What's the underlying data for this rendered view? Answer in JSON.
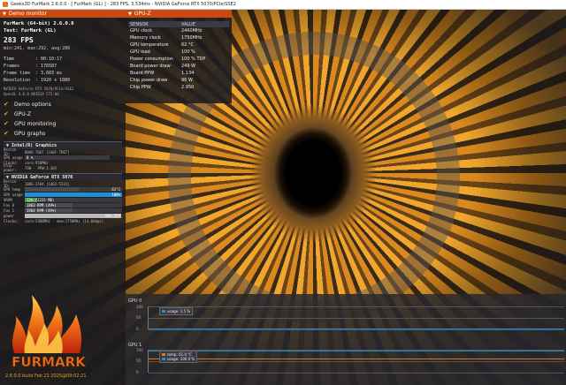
{
  "window": {
    "title": "Geeks3D FurMark 2.6.0.0 - [ FurMark (GL) ] - 283 FPS, 3.534ms - NVIDIA GeForce RTX 5070/PCIe/SSE2"
  },
  "demo_monitor": {
    "header": "Demo monitor",
    "title_line": "FurMark (64-bit) 2.6.0.0",
    "test_line": "Test: FurMark (GL)",
    "fps": "283 FPS",
    "minmaxavg": "min:241, max:292, avg:286",
    "stats": [
      {
        "k": "Time",
        "v": ": 00:10:17"
      },
      {
        "k": "Frames",
        "v": ": 176587"
      },
      {
        "k": "Frame time",
        "v": ": 3.603 ms"
      },
      {
        "k": "Resolution",
        "v": ": 1920 x 1080"
      }
    ],
    "gl_renderer": "NVIDIA GeForce RTX 5070/PCIe/SSE2",
    "gl_version": "OpenGL 4.6.0 NVIDIA 572.00",
    "options": [
      {
        "label": "Demo options"
      },
      {
        "label": "GPU-Z"
      },
      {
        "label": "GPU monitoring"
      },
      {
        "label": "GPU graphs"
      }
    ]
  },
  "intel_gpu": {
    "header": "Intel(R) Graphics",
    "rows": [
      {
        "k": "Device ID:",
        "v": "8086-7D67 [1A0F-7D67]"
      },
      {
        "k": "GPU usage",
        "bar": "0 %"
      },
      {
        "k": "Clocks:",
        "v": "core:950MHz"
      },
      {
        "k": "Chip power:",
        "v": "79W - PPW:3.305"
      }
    ]
  },
  "nvidia_gpu": {
    "header": "NVIDIA GeForce RTX 5070",
    "device": "10DE-2F04 [1462-5331]",
    "rows": [
      {
        "k": "GPU temp",
        "text": "61°C",
        "fill": 0.55,
        "color": "#4a4a52"
      },
      {
        "k": "GPU usage",
        "text": "100%",
        "fill": 1.0,
        "color": "#1f8fd4"
      },
      {
        "k": "VRAM",
        "text": "13% (1233 MB)",
        "fill": 0.13,
        "color": "#4a9a4a"
      },
      {
        "k": "Fan 0",
        "text": "1863 RPM (49%)",
        "fill": 0.49,
        "color": "#4a4a52"
      },
      {
        "k": "Fan 1",
        "text": "1964 RPM (49%)",
        "fill": 0.49,
        "color": "#4a4a52"
      },
      {
        "k": "power",
        "text": "99% TDP",
        "fill": 0.99,
        "color": "#b8b8b8"
      }
    ],
    "clocks": "core:2460MHz - mem:1750MHz (14.0Gbps)"
  },
  "logo_text": "FURMARK",
  "build": "2.6.0.0 build Feb 21 2025@09:02:21",
  "gpuz": {
    "header": "GPU-Z",
    "col_sensor": "SENSOR",
    "col_value": "VALUE",
    "rows": [
      {
        "s": "GPU clock",
        "v": "2460MHz"
      },
      {
        "s": "Memory clock",
        "v": "1750MHz"
      },
      {
        "s": "GPU temperature",
        "v": "62 °C"
      },
      {
        "s": "GPU load",
        "v": "100 %"
      },
      {
        "s": "Power consumption",
        "v": "100 % TDP"
      },
      {
        "s": "Board power draw",
        "v": "249 W"
      },
      {
        "s": "Board PPW",
        "v": "1.134"
      },
      {
        "s": "Chip power draw",
        "v": "96 W"
      },
      {
        "s": "Chip PPW",
        "v": "2.950"
      }
    ]
  },
  "graphs": {
    "gpu0": {
      "label": "GPU 0",
      "ticks": [
        "100",
        "50",
        "0"
      ],
      "legend": [
        "usage: 1.5 %"
      ]
    },
    "gpu1": {
      "label": "GPU 1",
      "ticks": [
        "100",
        "50",
        "0"
      ],
      "legend": [
        "temp: 61.0 °C",
        "usage: 100.0 %"
      ]
    },
    "colors": {
      "usage": "#1f8fd4",
      "temp": "#e8741a"
    }
  }
}
